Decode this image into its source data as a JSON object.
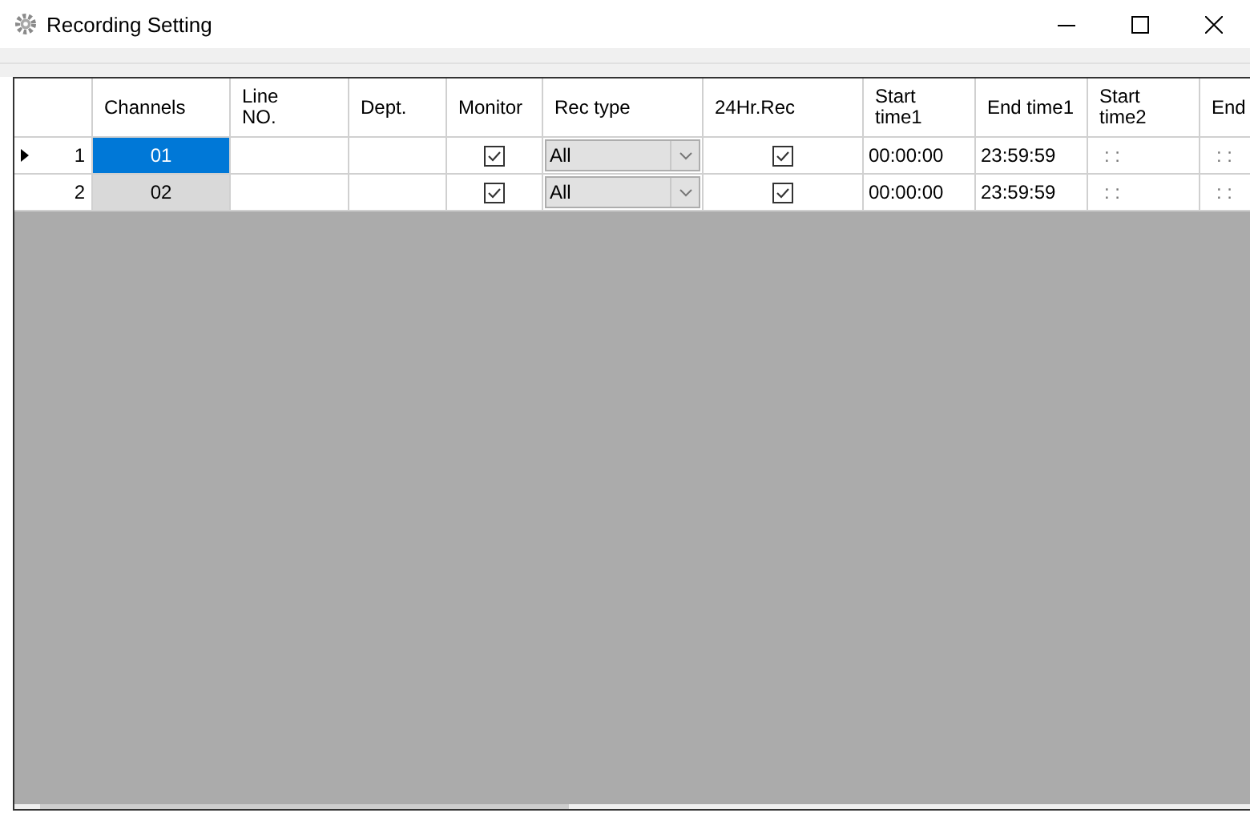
{
  "window": {
    "title": "Recording Setting"
  },
  "table": {
    "columns": [
      "Channels",
      "Line\nNO.",
      "Dept.",
      "Monitor",
      "Rec type",
      "24Hr.Rec",
      "Start\ntime1",
      "End time1",
      "Start\ntime2",
      "End"
    ],
    "rows": [
      {
        "number": "1",
        "current": true,
        "channel": "01",
        "selected": true,
        "line_no": "",
        "dept": "",
        "monitor": true,
        "rec_type": "All",
        "hr24": true,
        "start_time1": "00:00:00",
        "end_time1": "23:59:59",
        "start_time2": ": :",
        "end_time2": ": :"
      },
      {
        "number": "2",
        "current": false,
        "channel": "02",
        "selected": false,
        "line_no": "",
        "dept": "",
        "monitor": true,
        "rec_type": "All",
        "hr24": true,
        "start_time1": "00:00:00",
        "end_time1": "23:59:59",
        "start_time2": ": :",
        "end_time2": ": :"
      }
    ]
  }
}
